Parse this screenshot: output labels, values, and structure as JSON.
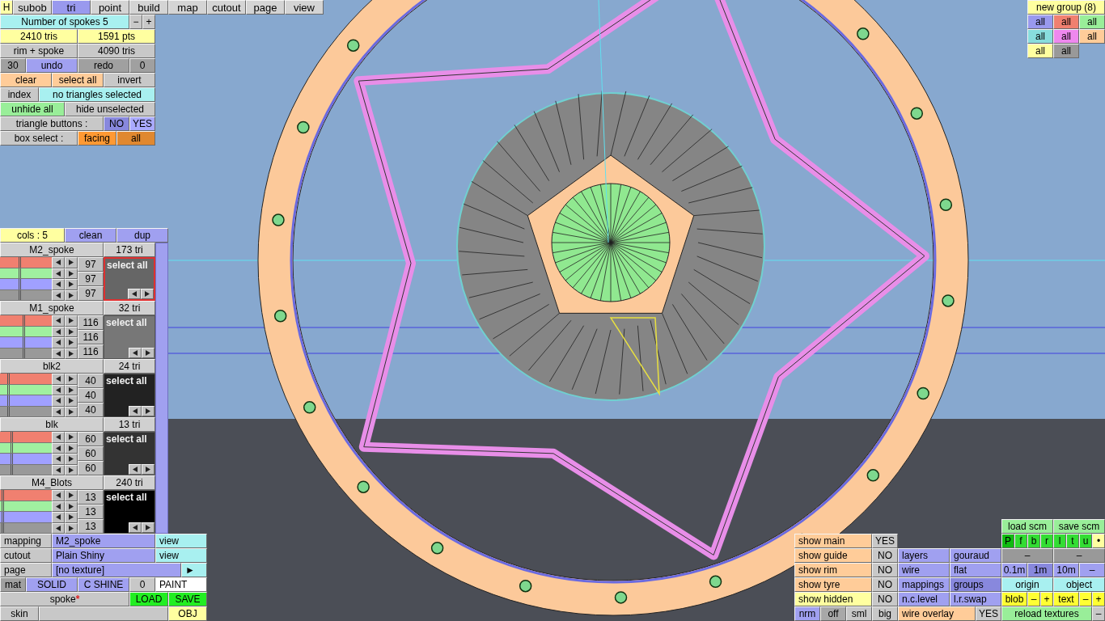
{
  "home_button": {
    "text": "H",
    "color": "#ffffa8"
  },
  "tabs": [
    {
      "text": "subob",
      "selected": false
    },
    {
      "text": "tri",
      "selected": true
    },
    {
      "text": "point",
      "selected": false
    },
    {
      "text": "build",
      "selected": false
    },
    {
      "text": "map",
      "selected": false
    },
    {
      "text": "cutout",
      "selected": false
    },
    {
      "text": "page",
      "selected": false
    },
    {
      "text": "view",
      "selected": false
    }
  ],
  "tools": {
    "buttons": [
      {
        "text": "Number of spokes 5",
        "color": "#a8f0f0"
      },
      {
        "text": "−",
        "color": "#c8c8c8"
      },
      {
        "text": "+",
        "color": "#c8c8c8"
      },
      {
        "text": "2410 tris",
        "color": "#ffffa0"
      },
      {
        "text": "1591 pts",
        "color": "#ffffa0"
      },
      {
        "text": "rim + spoke",
        "color": "#c8c8c8"
      },
      {
        "text": "4090 tris",
        "color": "#c8c8c8"
      },
      {
        "text": "30",
        "color": "#a0a0a0"
      },
      {
        "text": "undo",
        "color": "#a0a0f0"
      },
      {
        "text": "redo",
        "color": "#a0a0a0"
      },
      {
        "text": "0",
        "color": "#a0a0a0"
      },
      {
        "text": "clear",
        "color": "#ffcc99"
      },
      {
        "text": "select all",
        "color": "#ffcc99"
      },
      {
        "text": "invert",
        "color": "#c8c8c8"
      },
      {
        "text": "index",
        "color": "#c8c8c8"
      },
      {
        "text": "no triangles selected",
        "color": "#a8f0f0"
      },
      {
        "text": "unhide all",
        "color": "#99ee99"
      },
      {
        "text": "hide unselected",
        "color": "#c8c8c8"
      },
      {
        "text": "triangle buttons :",
        "color": "#c8c8c8"
      },
      {
        "text": "NO",
        "color": "#8888dd"
      },
      {
        "text": "YES",
        "color": "#aaaaff"
      },
      {
        "text": "box select :",
        "color": "#c8c8c8"
      },
      {
        "text": "facing",
        "color": "#ff9933"
      },
      {
        "text": "all",
        "color": "#e08830"
      }
    ]
  },
  "groups": {
    "buttons": [
      {
        "text": "new group (8)",
        "color": "#ffffa0"
      },
      {
        "text": "all",
        "color": "#9999ee"
      },
      {
        "text": "all",
        "color": "#f08070"
      },
      {
        "text": "all",
        "color": "#99ee99"
      },
      {
        "text": "all",
        "color": "#88dddd"
      },
      {
        "text": "all",
        "color": "#ee88ee"
      },
      {
        "text": "all",
        "color": "#ffcc99"
      },
      {
        "text": "all",
        "color": "#ffffa0"
      },
      {
        "text": "all",
        "color": "#999999"
      }
    ]
  },
  "materials": {
    "header": [
      {
        "text": "cols : 5",
        "color": "#ffffa0"
      },
      {
        "text": "clean",
        "color": "#a0a0f0"
      },
      {
        "text": "dup",
        "color": "#a0a0f0"
      }
    ],
    "items": [
      {
        "name": "M2_spoke",
        "tris": "173 tri",
        "selected": true,
        "color": "#666666",
        "select_label": "select all",
        "sliders": [
          {
            "level": 0.37
          },
          {
            "level": 0.37
          },
          {
            "level": 0.37
          },
          {
            "level": 0.37
          }
        ],
        "values": [
          "97",
          "97",
          "97"
        ]
      },
      {
        "name": "M1_spoke",
        "tris": "32 tri",
        "selected": false,
        "color": "#777777",
        "select_label": "select all",
        "sliders": [
          {
            "level": 0.45
          },
          {
            "level": 0.45
          },
          {
            "level": 0.45
          },
          {
            "level": 0.45
          }
        ],
        "values": [
          "116",
          "116",
          "116"
        ]
      },
      {
        "name": "blk2",
        "tris": "24 tri",
        "selected": false,
        "color": "#222222",
        "select_label": "select all",
        "sliders": [
          {
            "level": 0.15
          },
          {
            "level": 0.15
          },
          {
            "level": 0.15
          },
          {
            "level": 0.15
          }
        ],
        "values": [
          "40",
          "40",
          "40"
        ]
      },
      {
        "name": "blk",
        "tris": "13 tri",
        "selected": false,
        "color": "#333333",
        "select_label": "select all",
        "sliders": [
          {
            "level": 0.22
          },
          {
            "level": 0.22
          },
          {
            "level": 0.22
          },
          {
            "level": 0.22
          }
        ],
        "values": [
          "60",
          "60",
          "60"
        ]
      },
      {
        "name": "M4_Blots",
        "tris": "240 tri",
        "selected": false,
        "color": "#000000",
        "select_label": "select all",
        "sliders": [
          {
            "level": 0.04
          },
          {
            "level": 0.04
          },
          {
            "level": 0.04
          },
          {
            "level": 0.04
          }
        ],
        "values": [
          "13",
          "13",
          "13"
        ]
      }
    ]
  },
  "material_settings": {
    "buttons": [
      {
        "text": "mapping",
        "color": "#c8c8c8"
      },
      {
        "text": "M2_spoke",
        "color": "#a0a0f0"
      },
      {
        "text": "view",
        "color": "#a8f0f0"
      },
      {
        "text": "cutout",
        "color": "#c8c8c8"
      },
      {
        "text": "Plain Shiny",
        "color": "#a0a0f0"
      },
      {
        "text": "view",
        "color": "#a8f0f0"
      },
      {
        "text": "page",
        "color": "#c8c8c8"
      },
      {
        "text": "[no texture]",
        "color": "#a0a0f0"
      },
      {
        "text": "►",
        "color": "#a8f0f0"
      },
      {
        "text": "mat",
        "color": "#a0a0a0"
      },
      {
        "text": "SOLID",
        "color": "#a0a0f0"
      },
      {
        "text": "C SHINE",
        "color": "#a0a0f0"
      },
      {
        "text": "0",
        "color": "#c8c8c8"
      },
      {
        "text": "PAINT",
        "color": "#ffffff"
      },
      {
        "text": "spoke",
        "mark": "*",
        "color": "#c8c8c8"
      },
      {
        "text": "LOAD",
        "color": "#22ee22"
      },
      {
        "text": "SAVE",
        "color": "#22ee22"
      },
      {
        "text": "skin",
        "color": "#c8c8c8"
      },
      {
        "color": "#c8c8c8"
      },
      {
        "text": "OBJ",
        "color": "#ffffa0"
      }
    ]
  },
  "display": {
    "buttons": [
      {
        "text": "show main",
        "color": "#ffcc99"
      },
      {
        "text": "YES",
        "color": "#c8c8c8"
      },
      {
        "text": "show guide",
        "color": "#ffcc99"
      },
      {
        "text": "NO",
        "color": "#c8c8c8"
      },
      {
        "text": "layers",
        "color": "#a0a0f0"
      },
      {
        "text": "gouraud",
        "color": "#a0a0f0"
      },
      {
        "text": "show rim",
        "color": "#ffcc99"
      },
      {
        "text": "NO",
        "color": "#c8c8c8"
      },
      {
        "text": "wire",
        "color": "#a0a0f0"
      },
      {
        "text": "flat",
        "color": "#a0a0f0"
      },
      {
        "text": "show tyre",
        "color": "#ffcc99"
      },
      {
        "text": "NO",
        "color": "#c8c8c8"
      },
      {
        "text": "mappings",
        "color": "#a0a0f0"
      },
      {
        "text": "groups",
        "color": "#8888dd"
      },
      {
        "text": "show hidden",
        "color": "#ffffa0"
      },
      {
        "text": "NO",
        "color": "#c8c8c8"
      },
      {
        "text": "n.c.level",
        "color": "#a0a0f0"
      },
      {
        "text": "l.r.swap",
        "color": "#a0a0f0"
      },
      {
        "text": "nrm",
        "color": "#a0a0f0"
      },
      {
        "text": "off",
        "color": "#a8a8a8"
      },
      {
        "text": "sml",
        "color": "#c8c8c8"
      },
      {
        "text": "big",
        "color": "#c8c8c8"
      },
      {
        "text": "wire overlay",
        "color": "#ffcc99"
      },
      {
        "text": "YES",
        "color": "#c8c8c8"
      }
    ]
  },
  "view_controls": {
    "buttons": [
      {
        "text": "load scm",
        "color": "#99ee99"
      },
      {
        "text": "save scm",
        "color": "#99ee99"
      },
      {
        "text": "P",
        "color": "#11bb11"
      },
      {
        "text": "f",
        "color": "#33dd33"
      },
      {
        "text": "b",
        "color": "#33dd33"
      },
      {
        "text": "r",
        "color": "#33dd33"
      },
      {
        "text": "l",
        "color": "#33dd33"
      },
      {
        "text": "t",
        "color": "#33dd33"
      },
      {
        "text": "u",
        "color": "#33dd33"
      },
      {
        "text": "•",
        "color": "#ffffa0"
      },
      {
        "text": "–",
        "color": "#999999"
      },
      {
        "text": "–",
        "color": "#999999"
      },
      {
        "text": "0.1m",
        "color": "#a0a0f0"
      },
      {
        "text": "1m",
        "color": "#8888dd"
      },
      {
        "text": "10m",
        "color": "#a0a0f0"
      },
      {
        "text": "–",
        "color": "#a0a0f0"
      },
      {
        "text": "origin",
        "color": "#a8f0f0"
      },
      {
        "text": "object",
        "color": "#a8f0f0"
      },
      {
        "text": "blob",
        "color": "#ffff33"
      },
      {
        "text": "–",
        "color": "#ffff33"
      },
      {
        "text": "+",
        "color": "#ffff33"
      },
      {
        "text": "text",
        "color": "#ffff33"
      },
      {
        "text": "–",
        "color": "#ffff33"
      },
      {
        "text": "+",
        "color": "#ffff33"
      },
      {
        "text": "reload textures",
        "color": "#99ee99"
      },
      {
        "text": "–",
        "color": "#c8c8c8"
      }
    ]
  }
}
